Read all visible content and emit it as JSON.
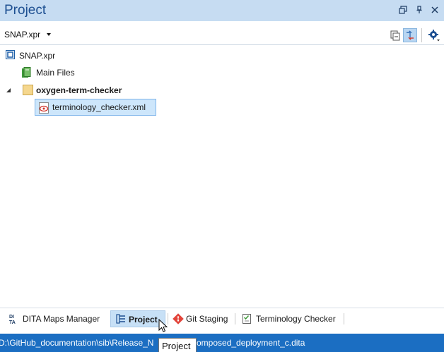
{
  "panel": {
    "title": "Project"
  },
  "toolbar": {
    "project_file": "SNAP.xpr"
  },
  "tree": {
    "root": {
      "label": "SNAP.xpr",
      "icon": "project-file-icon"
    },
    "main_files": {
      "label": "Main Files",
      "icon": "main-files-icon"
    },
    "folder": {
      "label": "oxygen-term-checker",
      "expanded": true,
      "icon": "folder-icon"
    },
    "file": {
      "label": "terminology_checker.xml",
      "selected": true,
      "icon": "xml-file-icon"
    }
  },
  "tabs": [
    {
      "label": "DITA Maps Manager",
      "icon": "dita-icon",
      "active": false
    },
    {
      "label": "Project",
      "icon": "project-tree-icon",
      "active": true
    },
    {
      "label": "Git Staging",
      "icon": "git-icon",
      "active": false
    },
    {
      "label": "Terminology Checker",
      "icon": "checklist-icon",
      "active": false
    }
  ],
  "status": {
    "path": "D:\\GitHub_documentation\\sib\\Release_N",
    "path_tail": "omposed_deployment_c.dita"
  },
  "tooltip": {
    "text": "Project"
  },
  "colors": {
    "title_bar": "#c6dcf2",
    "title_text": "#1d4f91",
    "status_bar": "#1b6ec2",
    "selection": "#cde6fb",
    "active_tab": "#c7e0f6",
    "folder": "#f5d78e"
  }
}
